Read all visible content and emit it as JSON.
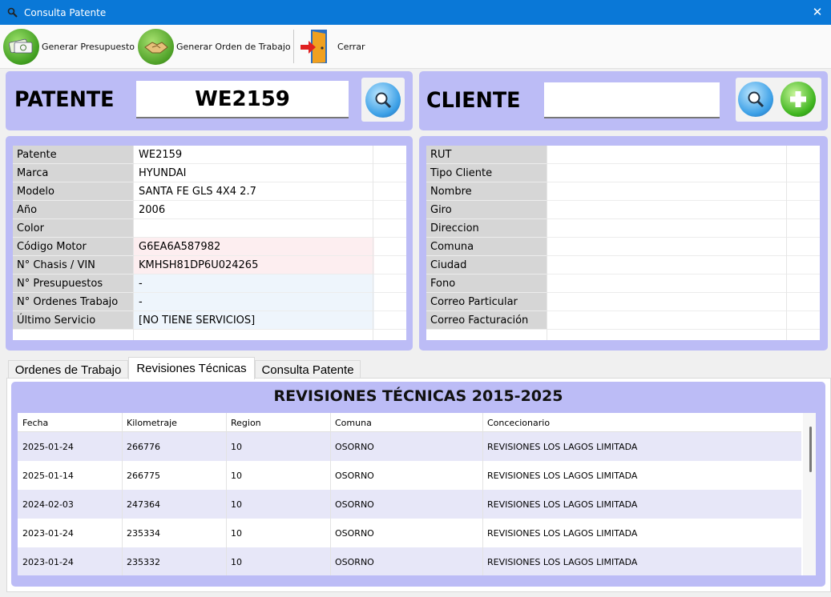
{
  "window": {
    "title": "Consulta Patente",
    "close_glyph": "✕"
  },
  "toolbar": {
    "presupuesto_label": "Generar Presupuesto",
    "orden_label": "Generar Orden de Trabajo",
    "cerrar_label": "Cerrar"
  },
  "patente_panel": {
    "title": "PATENTE",
    "value": "WE2159"
  },
  "cliente_panel": {
    "title": "CLIENTE",
    "value": ""
  },
  "vehicle": [
    {
      "label": "Patente",
      "value": "WE2159",
      "bg": "#ffffff"
    },
    {
      "label": "Marca",
      "value": "HYUNDAI",
      "bg": "#ffffff"
    },
    {
      "label": "Modelo",
      "value": "SANTA FE GLS 4X4 2.7",
      "bg": "#ffffff"
    },
    {
      "label": "Año",
      "value": "2006",
      "bg": "#ffffff"
    },
    {
      "label": "Color",
      "value": "",
      "bg": "#ffffff"
    },
    {
      "label": "Código Motor",
      "value": "G6EA6A587982",
      "bg": "#fdeef0"
    },
    {
      "label": "N° Chasis / VIN",
      "value": "KMHSH81DP6U024265",
      "bg": "#fdeef0"
    },
    {
      "label": "N° Presupuestos",
      "value": "-",
      "bg": "#eef5fc"
    },
    {
      "label": "N° Ordenes Trabajo",
      "value": "-",
      "bg": "#eef5fc"
    },
    {
      "label": "Último Servicio",
      "value": "[NO TIENE SERVICIOS]",
      "bg": "#eef5fc"
    }
  ],
  "client": [
    {
      "label": "RUT",
      "value": ""
    },
    {
      "label": "Tipo Cliente",
      "value": ""
    },
    {
      "label": "Nombre",
      "value": ""
    },
    {
      "label": "Giro",
      "value": ""
    },
    {
      "label": "Direccion",
      "value": ""
    },
    {
      "label": "Comuna",
      "value": ""
    },
    {
      "label": "Ciudad",
      "value": ""
    },
    {
      "label": "Fono",
      "value": ""
    },
    {
      "label": "Correo Particular",
      "value": ""
    },
    {
      "label": "Correo Facturación",
      "value": ""
    }
  ],
  "tabs": [
    {
      "label": "Ordenes de Trabajo",
      "active": false
    },
    {
      "label": "Revisiones Técnicas",
      "active": true
    },
    {
      "label": "Consulta Patente",
      "active": false
    }
  ],
  "revisiones": {
    "title": "REVISIONES TÉCNICAS 2015-2025",
    "columns": [
      "Fecha",
      "Kilometraje",
      "Region",
      "Comuna",
      "Concecionario"
    ],
    "rows": [
      [
        "2025-01-24",
        "266776",
        "10",
        "OSORNO",
        "REVISIONES LOS LAGOS LIMITADA"
      ],
      [
        "2025-01-14",
        "266775",
        "10",
        "OSORNO",
        "REVISIONES LOS LAGOS LIMITADA"
      ],
      [
        "2024-02-03",
        "247364",
        "10",
        "OSORNO",
        "REVISIONES LOS LAGOS LIMITADA"
      ],
      [
        "2023-01-24",
        "235334",
        "10",
        "OSORNO",
        "REVISIONES LOS LAGOS LIMITADA"
      ],
      [
        "2023-01-24",
        "235332",
        "10",
        "OSORNO",
        "REVISIONES LOS LAGOS LIMITADA"
      ]
    ],
    "alt_row_color": "#e7e7f8"
  },
  "colors": {
    "panel": "#bcbcf6",
    "titlebar": "#0a78d7"
  }
}
